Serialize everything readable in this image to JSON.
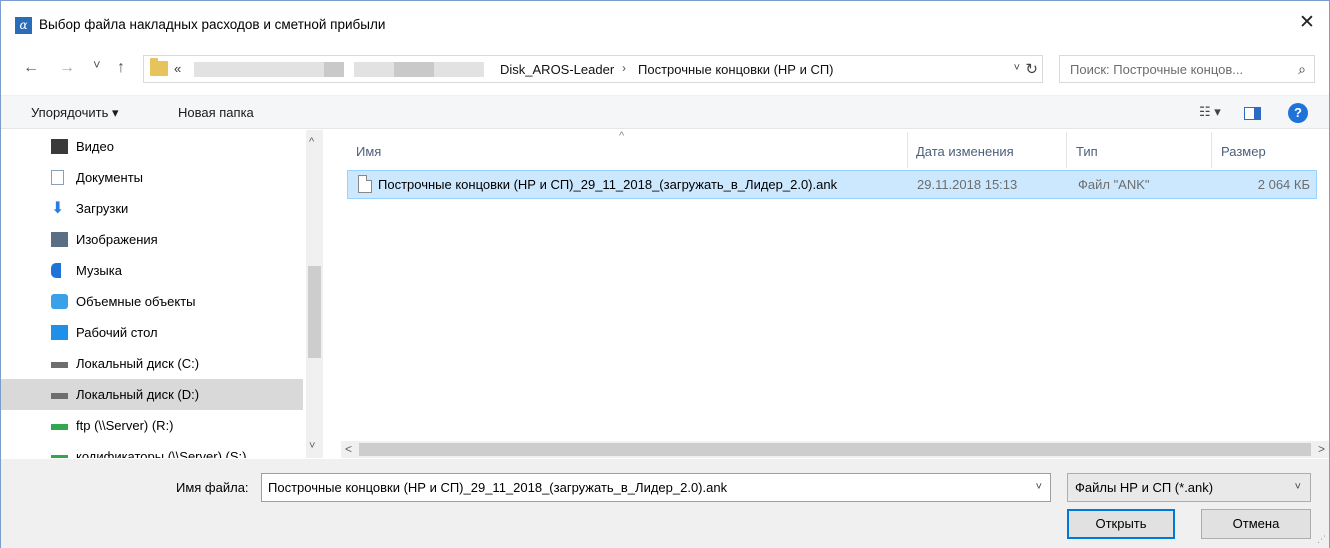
{
  "window": {
    "title": "Выбор файла накладных расходов и сметной прибыли",
    "app_icon_glyph": "α",
    "close_glyph": "✕"
  },
  "nav": {
    "back_glyph": "←",
    "forward_glyph": "→",
    "recent_glyph": "˅",
    "up_glyph": "↑"
  },
  "address": {
    "overflow_glyph": "«",
    "crumbs": [
      "Disk_AROS-Leader",
      "Построчные концовки (НР и СП)"
    ],
    "separator": "›",
    "dropdown_glyph": "˅",
    "refresh_glyph": "↻"
  },
  "search": {
    "placeholder": "Поиск: Построчные концов...",
    "icon_glyph": "⌕"
  },
  "toolbar": {
    "organize_label": "Упорядочить ▾",
    "new_folder_label": "Новая папка",
    "view_glyph": "☷ ▾",
    "help_glyph": "?"
  },
  "sidebar": {
    "items": [
      {
        "label": "Видео",
        "icon": "video-icon",
        "color": "#3a3a3a"
      },
      {
        "label": "Документы",
        "icon": "documents-icon",
        "color": "#8aa0b8"
      },
      {
        "label": "Загрузки",
        "icon": "downloads-icon",
        "color": "#2a7de1"
      },
      {
        "label": "Изображения",
        "icon": "images-icon",
        "color": "#5a6f86"
      },
      {
        "label": "Музыка",
        "icon": "music-icon",
        "color": "#1e73d9"
      },
      {
        "label": "Объемные объекты",
        "icon": "3d-objects-icon",
        "color": "#3aa0e8"
      },
      {
        "label": "Рабочий стол",
        "icon": "desktop-icon",
        "color": "#1f8fe8"
      },
      {
        "label": "Локальный диск (C:)",
        "icon": "system-drive-icon",
        "color": "#6e6e6e"
      },
      {
        "label": "Локальный диск (D:)",
        "icon": "drive-icon",
        "color": "#6e6e6e",
        "selected": true
      },
      {
        "label": "ftp (\\\\Server) (R:)",
        "icon": "network-drive-icon",
        "color": "#2fa84f"
      },
      {
        "label": "кодификаторы (\\\\Server) (S:)",
        "icon": "network-drive-icon",
        "color": "#2fa84f"
      }
    ],
    "scroll_up_glyph": "^",
    "scroll_down_glyph": "˅"
  },
  "filelist": {
    "columns": [
      "Имя",
      "Дата изменения",
      "Тип",
      "Размер"
    ],
    "sort_glyph": "^",
    "rows": [
      {
        "name": "Построчные концовки (НР и СП)_29_11_2018_(загружать_в_Лидер_2.0).ank",
        "date": "29.11.2018 15:13",
        "type": "Файл \"ANK\"",
        "size": "2 064 КБ"
      }
    ],
    "hscroll_left_glyph": "<",
    "hscroll_right_glyph": ">"
  },
  "footer": {
    "filename_label": "Имя файла:",
    "filename_value": "Построчные концовки (НР и СП)_29_11_2018_(загружать_в_Лидер_2.0).ank",
    "filename_dropdown_glyph": "˅",
    "filter_value": "Файлы НР и СП (*.ank)",
    "filter_dropdown_glyph": "˅",
    "open_label": "Открыть",
    "cancel_label": "Отмена",
    "grip_glyph": "⋰"
  },
  "colors": {
    "selection_bg": "#cce8ff",
    "selection_border": "#99d1ff",
    "accent": "#0078d7",
    "footer_bg": "#f0f0f0"
  }
}
